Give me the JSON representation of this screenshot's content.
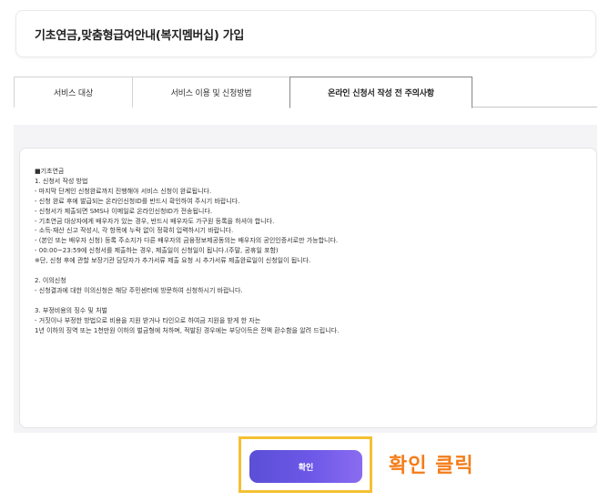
{
  "page": {
    "title": "기초연금,맞춤형급여안내(복지멤버십) 가입"
  },
  "tabs": [
    {
      "label": "서비스 대상",
      "active": false
    },
    {
      "label": "서비스 이용 및 신청방법",
      "active": false
    },
    {
      "label": "온라인 신청서 작성 전 주의사항",
      "active": true
    }
  ],
  "notice": {
    "lines": [
      "■기초연금",
      "1. 신청서 작성 방법",
      "- 마지막 단계인 신청완료까지 진행해야 서비스 신청이 완료됩니다.",
      "- 신청 완료 후에 발급되는 온라인신청ID를 반드시 확인하여 주시기 바랍니다.",
      "- 신청서가 제출되면 SMS나 이메일로 온라인신청ID가 전송됩니다.",
      "- 기초연금 대상자에게 배우자가 있는 경우, 반드시 배우자도 가구원 등록을 하셔야 합니다.",
      "- 소득·재산 신고 작성시, 각 항목에 누락 없이 정확히 입력하시기 바랍니다.",
      "- (본인 또는 배우자 신청) 등록 주소지가 다른 배우자의 금융정보제공동의는 배우자의 공인인증서로만 가능합니다.",
      "- 00:00~23:59에 신청서를 제출하는 경우, 제출일이 신청일이 됩니다.(주말, 공휴일 포함)",
      "  ※단, 신청 후에 관할 보장기관 담당자가 추가서류 제출 요청 시 추가서류 제출완료일이 신청일이 됩니다.",
      "",
      "2. 이의신청",
      "- 신청결과에 대한 이의신청은 해당 주민센터에 방문하여 신청하시기 바랍니다.",
      "",
      "3. 부정비용의 징수 및 처벌",
      "- 거짓이나 부정한 방법으로 비용을 지원 받거나 타인으로 하여금 지원을 받게 한 자는",
      "  1년 이하의 징역 또는 1천만원 이하의 벌금형에 처하며, 적발된 경우에는 부당이득은 전액 환수함을 알려 드립니다."
    ]
  },
  "actions": {
    "confirm_label": "확인"
  },
  "annotation": {
    "text": "확인 클릭",
    "color": "#f57c17",
    "highlight_color": "#f5c033"
  }
}
